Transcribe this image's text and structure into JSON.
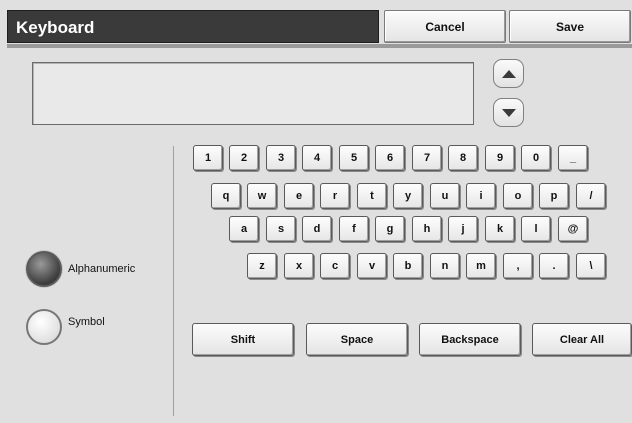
{
  "header": {
    "title": "Keyboard",
    "cancel_label": "Cancel",
    "save_label": "Save"
  },
  "input": {
    "value": ""
  },
  "keyboard": {
    "rows": [
      [
        "1",
        "2",
        "3",
        "4",
        "5",
        "6",
        "7",
        "8",
        "9",
        "0",
        "_"
      ],
      [
        "q",
        "w",
        "e",
        "r",
        "t",
        "y",
        "u",
        "i",
        "o",
        "p",
        "/"
      ],
      [
        "a",
        "s",
        "d",
        "f",
        "g",
        "h",
        "j",
        "k",
        "l",
        "@"
      ],
      [
        "z",
        "x",
        "c",
        "v",
        "b",
        "n",
        "m",
        ",",
        ".",
        "\\"
      ]
    ],
    "shift_label": "Shift",
    "space_label": "Space",
    "backspace_label": "Backspace",
    "clear_all_label": "Clear All"
  },
  "modes": [
    {
      "label": "Alphanumeric",
      "selected": true
    },
    {
      "label": "Symbol",
      "selected": false
    }
  ],
  "icons": {
    "scroll_up": "triangle-up-icon",
    "scroll_down": "triangle-down-icon"
  }
}
